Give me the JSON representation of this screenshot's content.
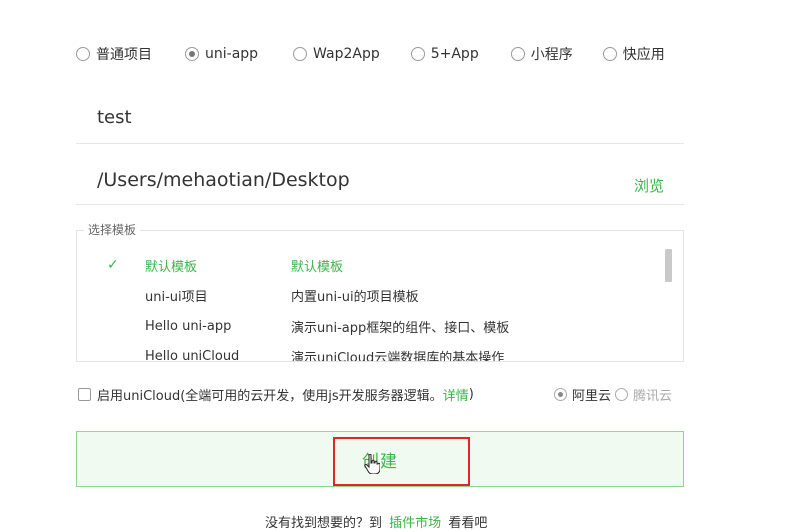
{
  "project_types": [
    {
      "label": "普通项目",
      "selected": false
    },
    {
      "label": "uni-app",
      "selected": true
    },
    {
      "label": "Wap2App",
      "selected": false
    },
    {
      "label": "5+App",
      "selected": false
    },
    {
      "label": "小程序",
      "selected": false
    },
    {
      "label": "快应用",
      "selected": false
    }
  ],
  "project_name": {
    "value": "test"
  },
  "project_path": {
    "value": "/Users/mehaotian/Desktop",
    "browse_label": "浏览"
  },
  "templates": {
    "legend": "选择模板",
    "check_mark": "✓",
    "items": [
      {
        "name": "默认模板",
        "desc": "默认模板",
        "selected": true
      },
      {
        "name": "uni-ui项目",
        "desc": "内置uni-ui的项目模板",
        "selected": false
      },
      {
        "name": "Hello uni-app",
        "desc": "演示uni-app框架的组件、接口、模板",
        "selected": false
      },
      {
        "name": "Hello uniCloud",
        "desc": "演示uniCloud云端数据库的基本操作",
        "selected": false
      }
    ]
  },
  "unicloud": {
    "label_prefix": "启用uniCloud(全端可用的云开发，使用js开发服务器逻辑。",
    "detail_link": "详情",
    "label_suffix": ")",
    "checked": false,
    "providers": [
      {
        "label": "阿里云",
        "selected": true,
        "enabled": true
      },
      {
        "label": "腾讯云",
        "selected": false,
        "enabled": false
      }
    ]
  },
  "create_button": {
    "label": "创建"
  },
  "footer": {
    "prefix": "没有找到想要的？到",
    "link": "插件市场",
    "suffix": "看看吧"
  },
  "colors": {
    "accent": "#3bb54a",
    "highlight": "#e0262b"
  }
}
